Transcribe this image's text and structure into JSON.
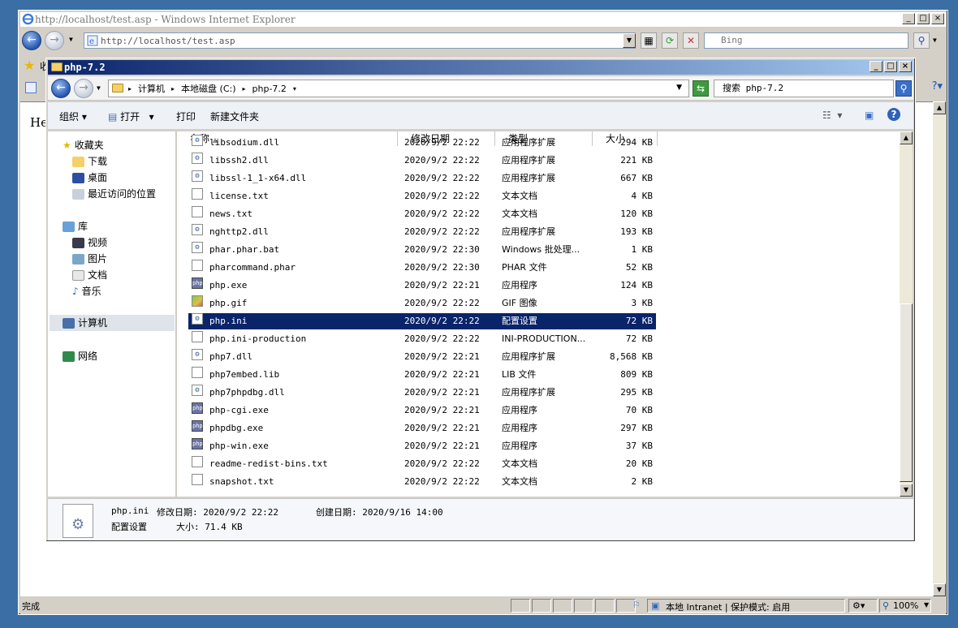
{
  "ie": {
    "title": "http://localhost/test.asp - Windows Internet Explorer",
    "url": "http://localhost/test.asp",
    "search_placeholder": "Bing",
    "page_text": "Hel",
    "fav_text": "收",
    "status_done": "完成",
    "status_zone": "本地 Intranet | 保护模式: 启用",
    "zoom": "100%"
  },
  "explorer": {
    "title": "php-7.2",
    "breadcrumb": [
      "计算机",
      "本地磁盘 (C:)",
      "php-7.2"
    ],
    "search_placeholder": "搜索 php-7.2",
    "commands": {
      "organize": "组织",
      "open": "打开",
      "print": "打印",
      "new_folder": "新建文件夹"
    },
    "columns": {
      "name": "名称",
      "date": "修改日期",
      "type": "类型",
      "size": "大小"
    },
    "nav": {
      "favorites": "收藏夹",
      "downloads": "下载",
      "desktop": "桌面",
      "recent": "最近访问的位置",
      "libraries": "库",
      "videos": "视频",
      "pictures": "图片",
      "documents": "文档",
      "music": "音乐",
      "computer": "计算机",
      "network": "网络"
    },
    "files": [
      {
        "name": "libsodium.dll",
        "date": "2020/9/2 22:22",
        "type": "应用程序扩展",
        "size": "294 KB",
        "icon": "dll"
      },
      {
        "name": "libssh2.dll",
        "date": "2020/9/2 22:22",
        "type": "应用程序扩展",
        "size": "221 KB",
        "icon": "dll"
      },
      {
        "name": "libssl-1_1-x64.dll",
        "date": "2020/9/2 22:22",
        "type": "应用程序扩展",
        "size": "667 KB",
        "icon": "dll"
      },
      {
        "name": "license.txt",
        "date": "2020/9/2 22:22",
        "type": "文本文档",
        "size": "4 KB",
        "icon": "txt"
      },
      {
        "name": "news.txt",
        "date": "2020/9/2 22:22",
        "type": "文本文档",
        "size": "120 KB",
        "icon": "txt"
      },
      {
        "name": "nghttp2.dll",
        "date": "2020/9/2 22:22",
        "type": "应用程序扩展",
        "size": "193 KB",
        "icon": "dll"
      },
      {
        "name": "phar.phar.bat",
        "date": "2020/9/2 22:30",
        "type": "Windows 批处理...",
        "size": "1 KB",
        "icon": "dll"
      },
      {
        "name": "pharcommand.phar",
        "date": "2020/9/2 22:30",
        "type": "PHAR 文件",
        "size": "52 KB",
        "icon": "txt"
      },
      {
        "name": "php.exe",
        "date": "2020/9/2 22:21",
        "type": "应用程序",
        "size": "124 KB",
        "icon": "php"
      },
      {
        "name": "php.gif",
        "date": "2020/9/2 22:22",
        "type": "GIF 图像",
        "size": "3 KB",
        "icon": "img"
      },
      {
        "name": "php.ini",
        "date": "2020/9/2 22:22",
        "type": "配置设置",
        "size": "72 KB",
        "icon": "dll",
        "selected": true
      },
      {
        "name": "php.ini-production",
        "date": "2020/9/2 22:22",
        "type": "INI-PRODUCTION...",
        "size": "72 KB",
        "icon": "txt"
      },
      {
        "name": "php7.dll",
        "date": "2020/9/2 22:21",
        "type": "应用程序扩展",
        "size": "8,568 KB",
        "icon": "dll"
      },
      {
        "name": "php7embed.lib",
        "date": "2020/9/2 22:21",
        "type": "LIB 文件",
        "size": "809 KB",
        "icon": "txt"
      },
      {
        "name": "php7phpdbg.dll",
        "date": "2020/9/2 22:21",
        "type": "应用程序扩展",
        "size": "295 KB",
        "icon": "dll"
      },
      {
        "name": "php-cgi.exe",
        "date": "2020/9/2 22:21",
        "type": "应用程序",
        "size": "70 KB",
        "icon": "php"
      },
      {
        "name": "phpdbg.exe",
        "date": "2020/9/2 22:21",
        "type": "应用程序",
        "size": "297 KB",
        "icon": "php"
      },
      {
        "name": "php-win.exe",
        "date": "2020/9/2 22:21",
        "type": "应用程序",
        "size": "37 KB",
        "icon": "php"
      },
      {
        "name": "readme-redist-bins.txt",
        "date": "2020/9/2 22:22",
        "type": "文本文档",
        "size": "20 KB",
        "icon": "txt"
      },
      {
        "name": "snapshot.txt",
        "date": "2020/9/2 22:22",
        "type": "文本文档",
        "size": "2 KB",
        "icon": "txt"
      }
    ],
    "details": {
      "filename": "php.ini",
      "modified": "修改日期: 2020/9/2 22:22",
      "created": "创建日期: 2020/9/16 14:00",
      "type": "配置设置",
      "size": "大小: 71.4 KB"
    }
  }
}
